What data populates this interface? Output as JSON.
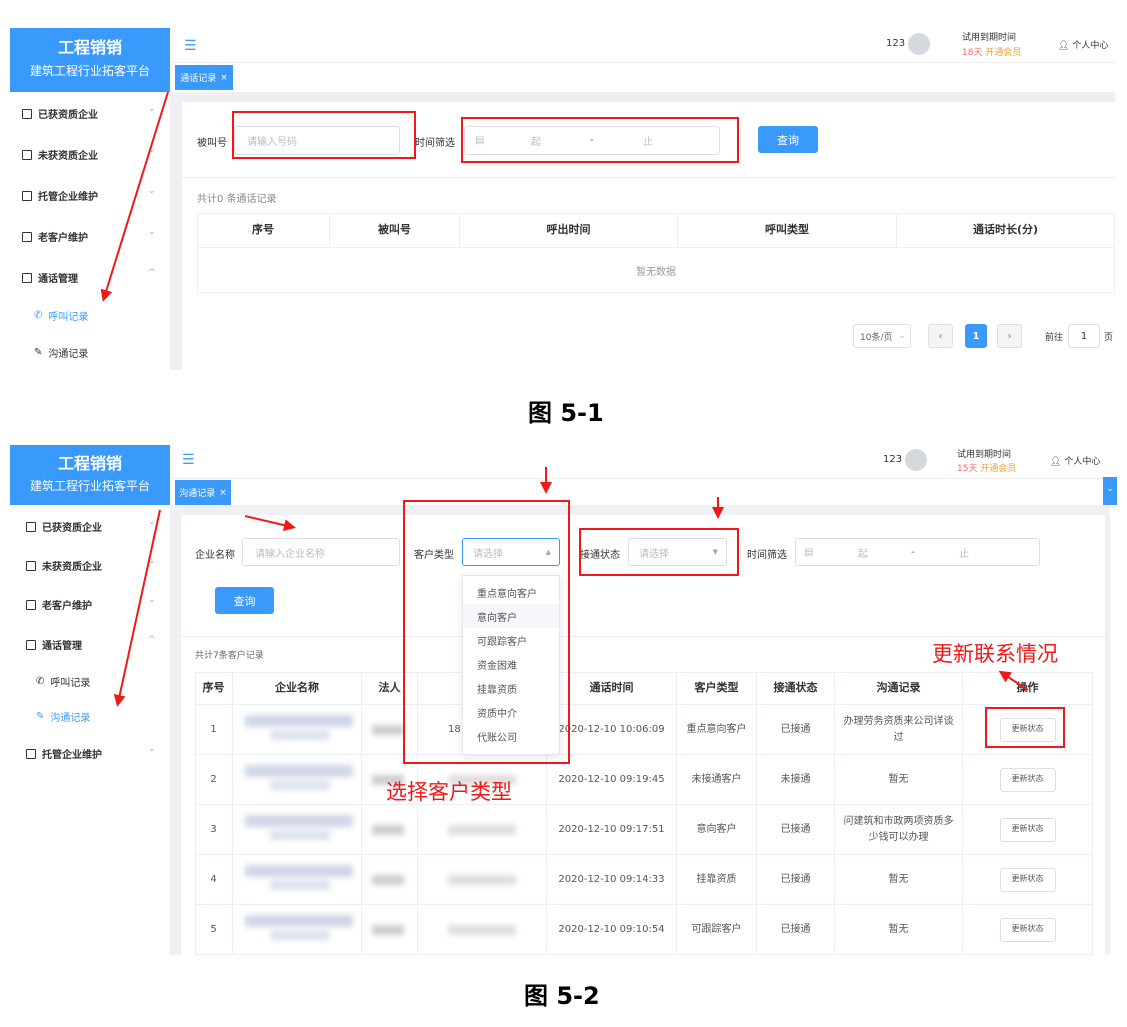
{
  "fig1": {
    "brand_title": "工程销销",
    "brand_subtitle": "建筑工程行业拓客平台",
    "menu": [
      {
        "label": "已获资质企业"
      },
      {
        "label": "未获资质企业"
      },
      {
        "label": "托管企业维护"
      },
      {
        "label": "老客户维护"
      },
      {
        "label": "通话管理"
      },
      {
        "label": "呼叫记录"
      },
      {
        "label": "沟通记录"
      }
    ],
    "user_id": "123",
    "trial_label": "试用到期时间",
    "trial_days": "18天",
    "upgrade_link": "开通会员",
    "profile": "个人中心",
    "tab": "通话记录",
    "filter": {
      "called_label": "被叫号",
      "called_placeholder": "请输入号码",
      "time_label": "时间筛选",
      "start": "起",
      "sep": "-",
      "end": "止",
      "query": "查询"
    },
    "count_text": "共计0 条通话记录",
    "columns": [
      "序号",
      "被叫号",
      "呼出时间",
      "呼叫类型",
      "通话时长(分)"
    ],
    "empty_text": "暂无数据",
    "pagination": {
      "page_size": "10条/页",
      "current": "1",
      "goto_label": "前往",
      "goto_value": "1",
      "page_suffix": "页"
    },
    "caption": "图 5-1"
  },
  "fig2": {
    "brand_title": "工程销销",
    "brand_subtitle": "建筑工程行业拓客平台",
    "menu": [
      {
        "label": "已获资质企业"
      },
      {
        "label": "未获资质企业"
      },
      {
        "label": "老客户维护"
      },
      {
        "label": "通话管理"
      },
      {
        "label": "呼叫记录"
      },
      {
        "label": "沟通记录"
      },
      {
        "label": "托管企业维护"
      }
    ],
    "user_id": "123",
    "trial_label": "试用到期时间",
    "trial_days": "15天",
    "upgrade_link": "开通会员",
    "profile": "个人中心",
    "tab": "沟通记录",
    "filter": {
      "company_label": "企业名称",
      "company_placeholder": "请输入企业名称",
      "type_label": "客户类型",
      "type_placeholder": "请选择",
      "status_label": "接通状态",
      "status_placeholder": "请选择",
      "time_label": "时间筛选",
      "start": "起",
      "sep": "-",
      "end": "止",
      "query": "查询"
    },
    "dropdown_options": [
      "重点意向客户",
      "意向客户",
      "可跟踪客户",
      "资金困难",
      "挂靠资质",
      "资质中介",
      "代账公司"
    ],
    "count_text": "共计7条客户记录",
    "columns": [
      "序号",
      "企业名称",
      "法人",
      "",
      "通话时间",
      "客户类型",
      "接通状态",
      "沟通记录",
      "操作"
    ],
    "rows": [
      {
        "no": "1",
        "phone": "18",
        "time": "2020-12-10 10:06:09",
        "type": "重点意向客户",
        "status": "已接通",
        "note": "办理劳务资质来公司详谈过",
        "action": "更新状态"
      },
      {
        "no": "2",
        "phone": "",
        "time": "2020-12-10 09:19:45",
        "type": "未接通客户",
        "status": "未接通",
        "note": "暂无",
        "action": "更新状态"
      },
      {
        "no": "3",
        "phone": "",
        "time": "2020-12-10 09:17:51",
        "type": "意向客户",
        "status": "已接通",
        "note": "问建筑和市政两项资质多少钱可以办理",
        "action": "更新状态"
      },
      {
        "no": "4",
        "phone": "",
        "time": "2020-12-10 09:14:33",
        "type": "挂靠资质",
        "status": "已接通",
        "note": "暂无",
        "action": "更新状态"
      },
      {
        "no": "5",
        "phone": "",
        "time": "2020-12-10 09:10:54",
        "type": "可跟踪客户",
        "status": "已接通",
        "note": "暂无",
        "action": "更新状态"
      }
    ],
    "annotation_select": "选择客户类型",
    "annotation_update": "更新联系情况",
    "caption": "图 5-2"
  },
  "colors": {
    "accent": "#3a9afc",
    "annotation": "#f01818",
    "warning": "#e6a23c",
    "danger": "#f56c6c"
  }
}
